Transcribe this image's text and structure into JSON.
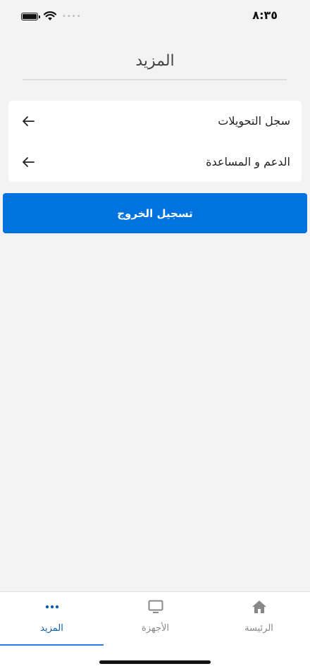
{
  "status_bar": {
    "time": "٨:٣٥",
    "signal_dots": "••••"
  },
  "header": {
    "title": "المزيد"
  },
  "menu": {
    "items": [
      {
        "label": "سجل التحويلات"
      },
      {
        "label": "الدعم و المساعدة"
      }
    ]
  },
  "logout": {
    "label": "تسجيل الخروج"
  },
  "bottom_nav": {
    "tabs": [
      {
        "label": "المزيد",
        "icon": "more-dots-icon",
        "active": true
      },
      {
        "label": "الأجهزة",
        "icon": "monitor-icon",
        "active": false
      },
      {
        "label": "الرئيسة",
        "icon": "home-icon",
        "active": false
      }
    ]
  },
  "colors": {
    "accent": "#0073df",
    "background": "#f3f3f3",
    "active_tab": "#0a5fb0"
  }
}
